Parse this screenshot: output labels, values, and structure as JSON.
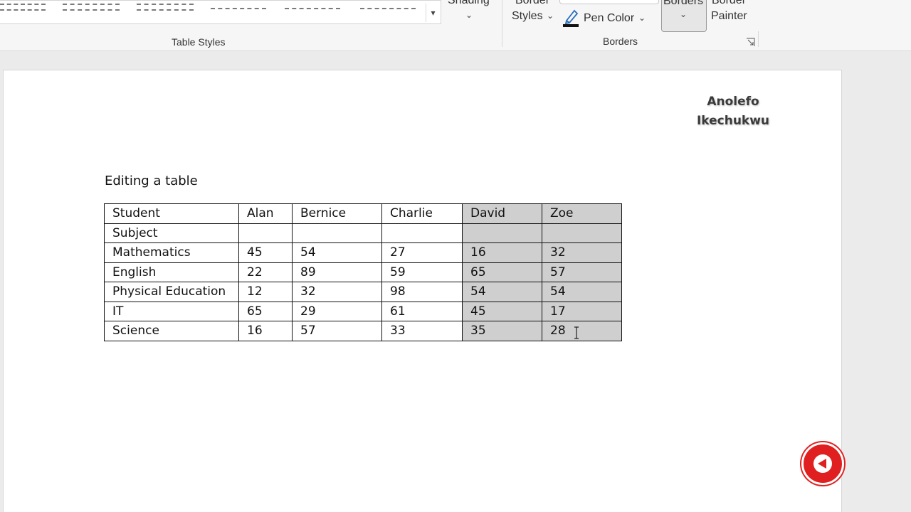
{
  "ribbon": {
    "groups": {
      "table_styles": "Table Styles",
      "borders": "Borders"
    },
    "shading_label": "Shading",
    "border_styles_line1": "Border",
    "border_styles_line2": "Styles",
    "pen_color_label": "Pen Color",
    "borders_label": "Borders",
    "border_painter_line1": "Border",
    "border_painter_line2": "Painter"
  },
  "document": {
    "watermark_line1": "Anolefo",
    "watermark_line2": "Ikechukwu",
    "heading": "Editing a table",
    "table": {
      "header": [
        "Student",
        "Alan",
        "Bernice",
        "Charlie",
        "David",
        "Zoe"
      ],
      "rows": [
        [
          "Subject",
          "",
          "",
          "",
          "",
          ""
        ],
        [
          "Mathematics",
          "45",
          "54",
          "27",
          "16",
          "32"
        ],
        [
          "English",
          "22",
          "89",
          "59",
          "65",
          "57"
        ],
        [
          "Physical Education",
          "12",
          "32",
          "98",
          "54",
          "54"
        ],
        [
          "IT",
          "65",
          "29",
          "61",
          "45",
          "17"
        ],
        [
          "Science",
          "16",
          "57",
          "33",
          "35",
          "28"
        ]
      ]
    }
  },
  "colors": {
    "selection": "#cfcfcf",
    "badge": "#e02020"
  }
}
